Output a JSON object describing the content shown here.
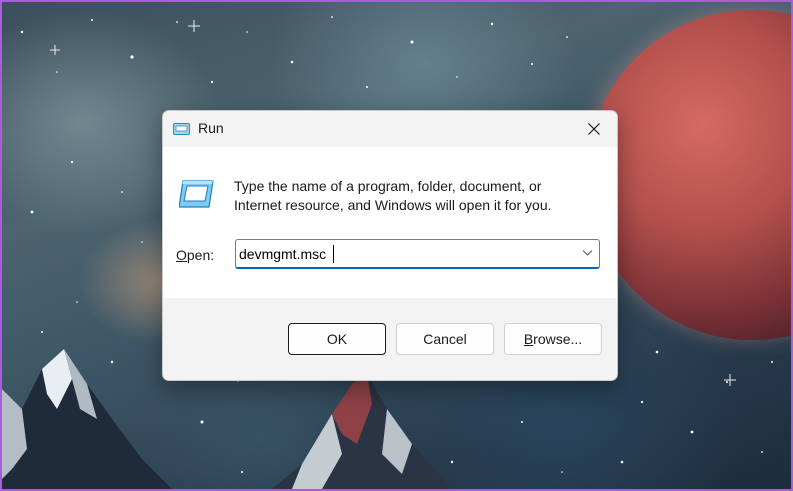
{
  "dialog": {
    "title": "Run",
    "description_line1": "Type the name of a program, folder, document, or",
    "description_line2": "Internet resource, and Windows will open it for you.",
    "open_label_mnemonic": "O",
    "open_label_rest": "pen:",
    "open_value": "devmgmt.msc",
    "buttons": {
      "ok": "OK",
      "cancel": "Cancel",
      "browse_mnemonic": "B",
      "browse_rest": "rowse..."
    }
  },
  "icons": {
    "title": "run-icon",
    "close": "close-icon",
    "content": "run-program-icon",
    "dropdown": "chevron-down-icon"
  },
  "colors": {
    "accent": "#0067c0",
    "frame_border": "#a85ed8",
    "dialog_bg": "#f3f3f3",
    "content_bg": "#ffffff"
  }
}
